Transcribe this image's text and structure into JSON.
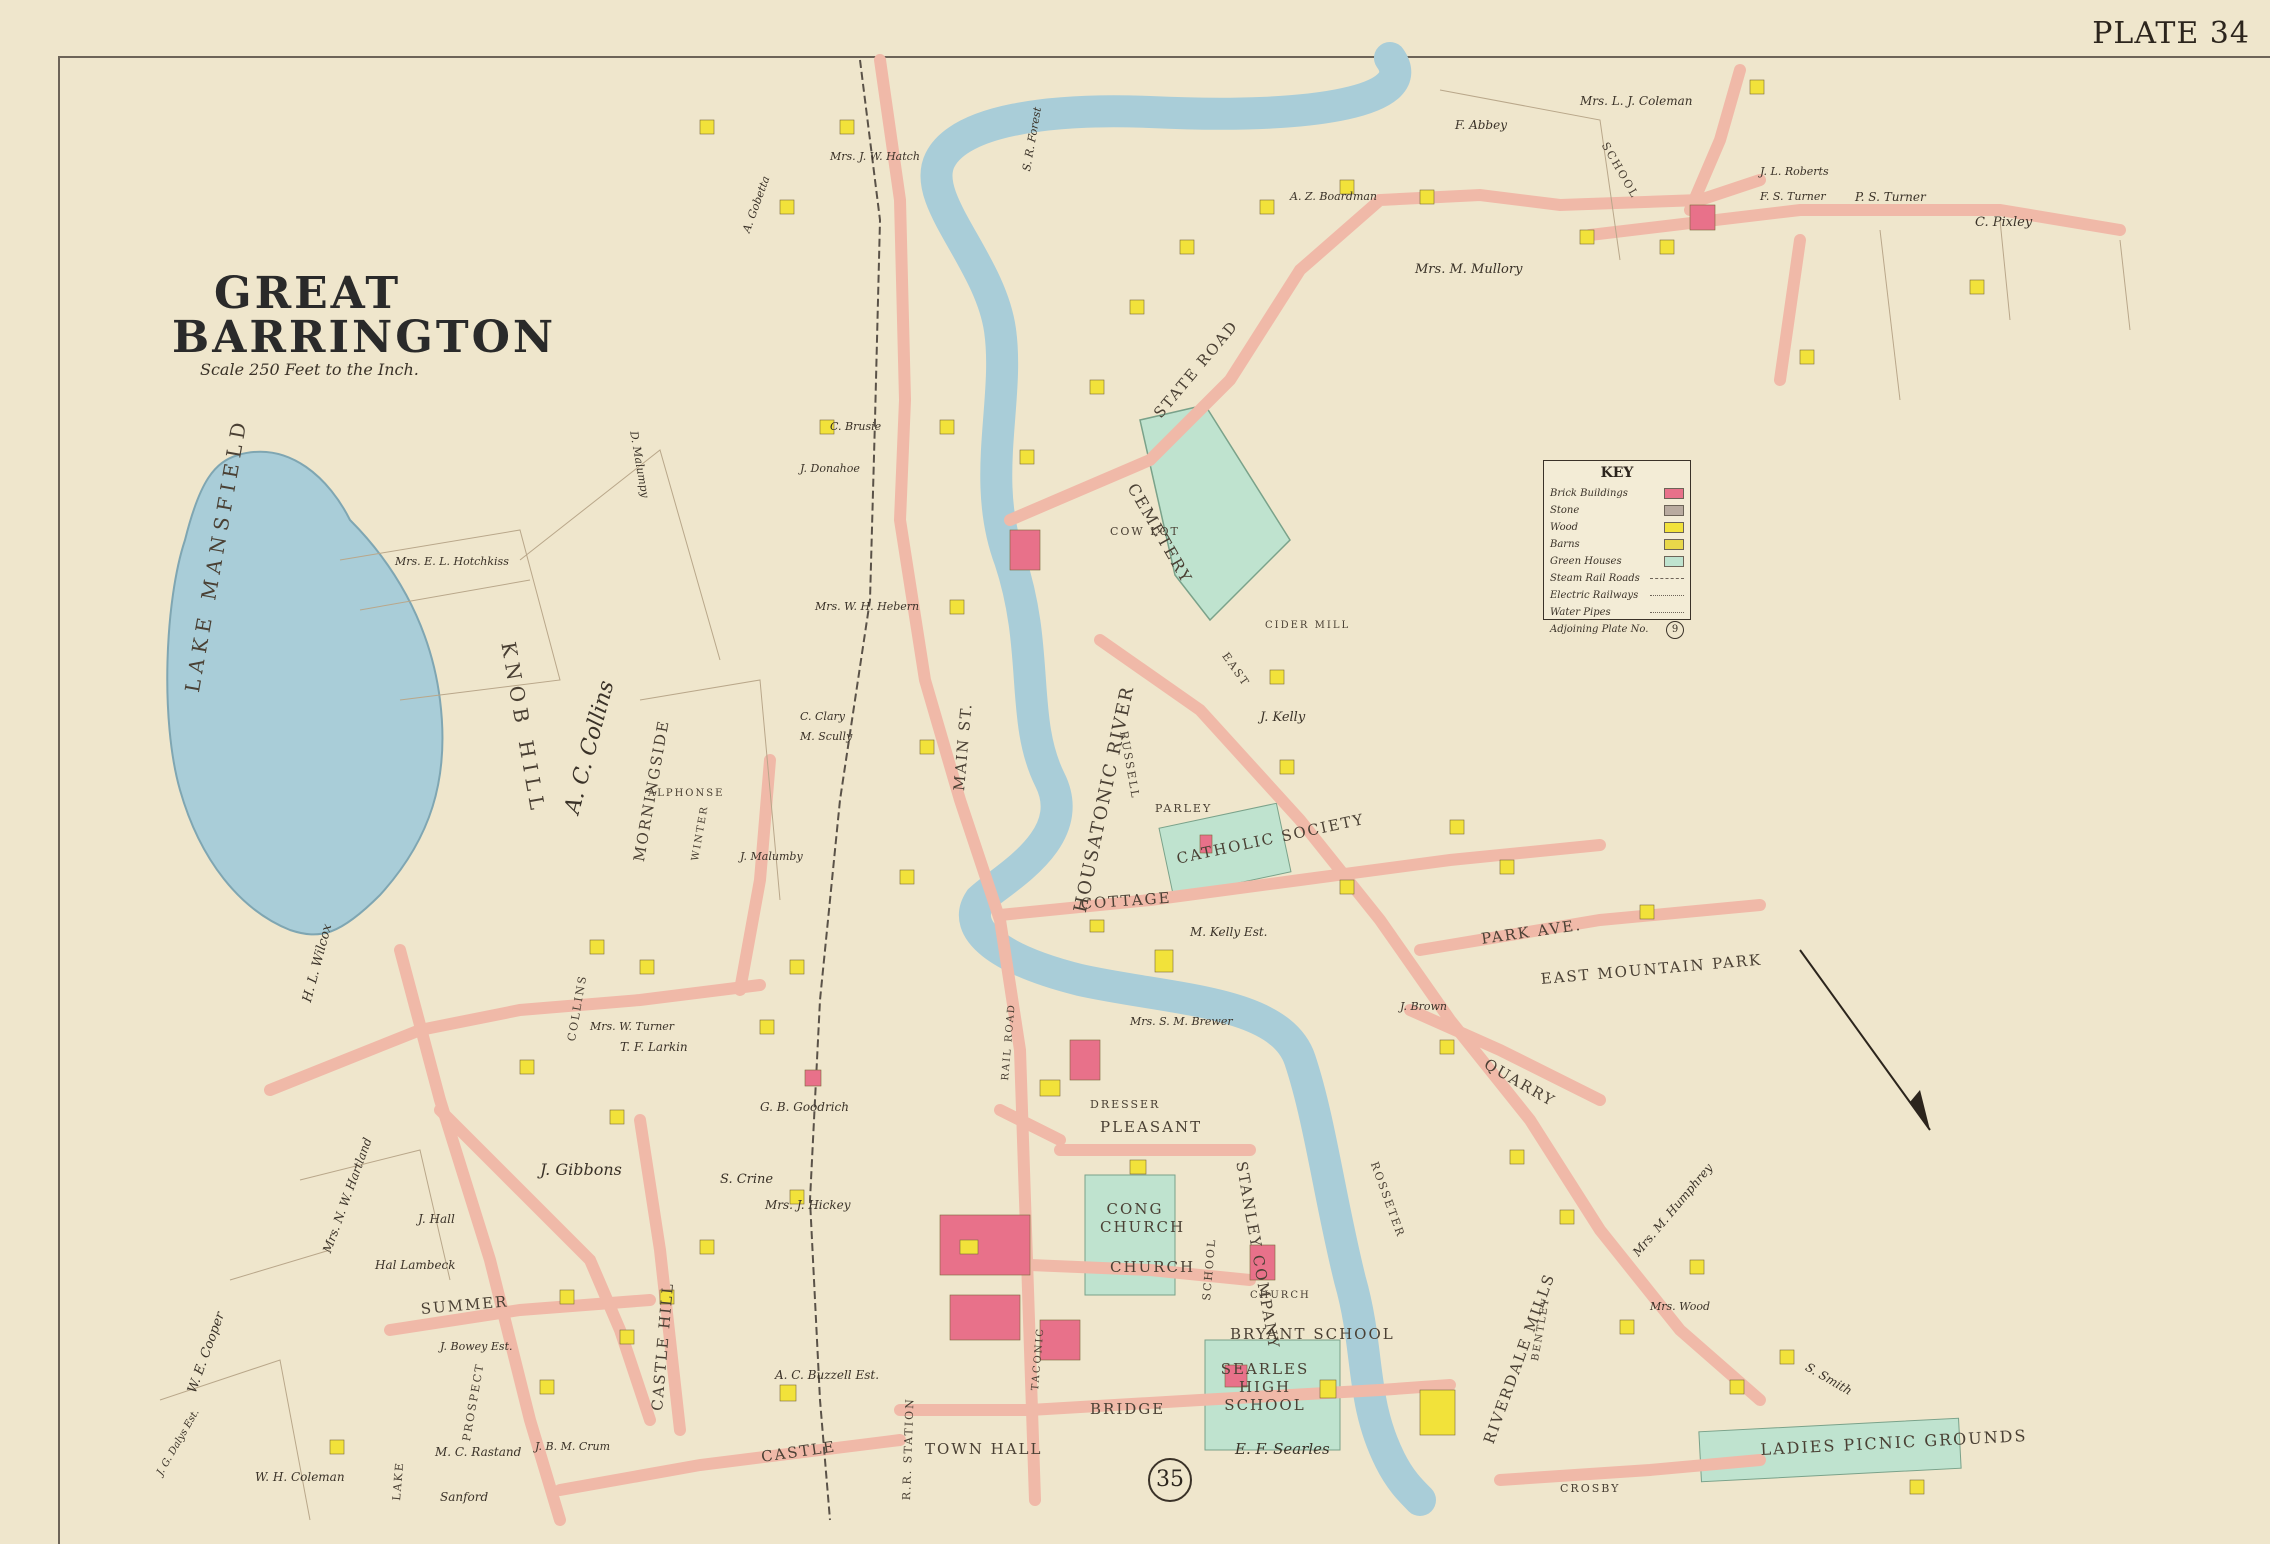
{
  "map": {
    "plate": "PLATE 34",
    "title_line1": "GREAT",
    "title_line2": "BARRINGTON",
    "scale": "Scale 250 Feet to the Inch.",
    "adjoining_plate": "35"
  },
  "key": {
    "title": "KEY",
    "items": [
      {
        "label": "Brick Buildings",
        "color": "#e8718a"
      },
      {
        "label": "Stone",
        "color": "#b9aba0"
      },
      {
        "label": "Wood",
        "color": "#f2e23a"
      },
      {
        "label": "Barns",
        "color": "#e9d84a"
      },
      {
        "label": "Green Houses",
        "color": "#bfe3cf"
      },
      {
        "label": "Steam Rail Roads"
      },
      {
        "label": "Electric Railways"
      },
      {
        "label": "Water Pipes"
      },
      {
        "label": "Adjoining Plate No.",
        "ref": "9"
      }
    ]
  },
  "features": {
    "lake": "LAKE MANSFIELD",
    "river": "HOUSATONIC RIVER",
    "cemetery": "CEMETERY",
    "catholic": "CATHOLIC SOCIETY",
    "east_mountain_park": "EAST MOUNTAIN PARK",
    "knob_hill": "KNOB HILL",
    "town_hall": "TOWN HALL",
    "picnic": "LADIES PICNIC GROUNDS",
    "bryant_school": "BRYANT SCHOOL",
    "searles_school": "SEARLES HIGH SCHOOL",
    "cong_church": "CONG CHURCH",
    "riverdale_mills": "RIVERDALE MILLS",
    "stanley_co": "STANLEY COMPANY",
    "school_top": "SCHOOL",
    "cowlot": "COW LOT"
  },
  "streets": {
    "state_road": "STATE ROAD",
    "main": "MAIN ST.",
    "cottage": "COTTAGE",
    "pleasant": "PLEASANT",
    "church": "CHURCH",
    "bridge": "BRIDGE",
    "castle": "CASTLE",
    "castle_hill": "CASTLE HILL",
    "park_ave": "PARK AVE.",
    "quarry": "QUARRY",
    "morningside": "MORNINGSIDE",
    "summer": "SUMMER",
    "collins": "COLLINS",
    "dresser": "DRESSER",
    "russell": "RUSSELL",
    "parley": "PARLEY",
    "crosby": "CROSBY",
    "prospect": "PROSPECT",
    "rosseter": "ROSSETER",
    "school_st": "SCHOOL",
    "alphonse": "ALPHONSE",
    "winter": "WINTER",
    "taconic": "TACONIC",
    "railroad": "RAIL ROAD",
    "east": "EAST",
    "lake": "LAKE",
    "station": "R.R. STATION",
    "cider_mill": "CIDER MILL",
    "church_st_east": "CHURCH",
    "bentley": "BENTLEY"
  },
  "owners": [
    "C. Pixley",
    "P. S. Turner",
    "Mrs. M. Mullory",
    "F. Abbey",
    "Mrs. L. J. Coleman",
    "S. R. Forest",
    "C. Brusie",
    "J. Donahoe",
    "A. Gobetta",
    "D. Malumpy",
    "Mrs. E. L. Hotchkiss",
    "A. C. Collins",
    "H. L. Wilcox",
    "Mrs. W. H. Hebern",
    "T. F. Larkin",
    "S. Crine",
    "J. Gibbons",
    "Hal Lambeck",
    "W. E. Cooper",
    "Mrs. N. W. Hartland",
    "J. Hall",
    "Mrs. W. Turner",
    "G. B. Goodrich",
    "Mrs. J. Hickey",
    "A. C. Buzzell Est.",
    "W. H. Coleman",
    "J. G. Dalys Est.",
    "Sanford",
    "M. C. Rastand",
    "Mrs. S. M. Brewer",
    "M. Kelly Est.",
    "J. Kelly",
    "Mrs. M. Humphrey",
    "J. Brown",
    "E. F. Searles",
    "S. Smith",
    "J. Bowey Est.",
    "J. B. M. Crum",
    "C. Clary",
    "M. Scully",
    "J. L. Roberts",
    "Mrs. J. W. Hatch",
    "A. Z. Boardman",
    "F. S. Turner",
    "J. Malumby",
    "Mrs. Wood"
  ],
  "colors": {
    "paper": "#efe6cc",
    "road": "#f0b9a8",
    "lake": "#a9cdd8",
    "wood_building": "#f2e23a",
    "brick_building": "#e8718a",
    "green": "#bfe3cf"
  }
}
